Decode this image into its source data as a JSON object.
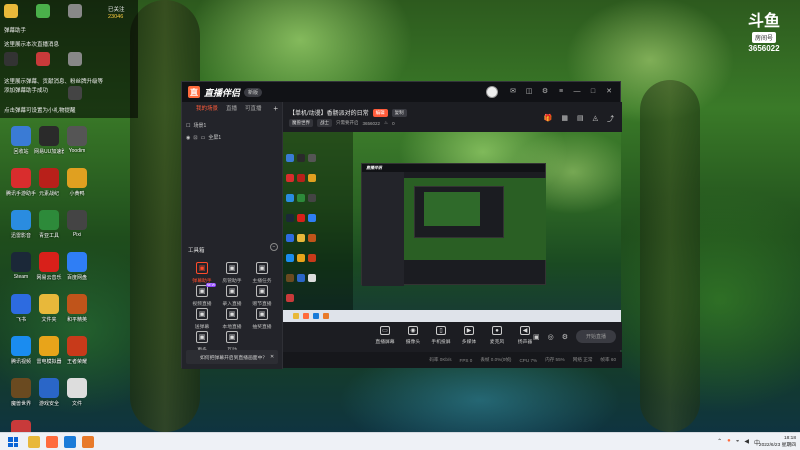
{
  "colors": {
    "accent": "#ff5b3a",
    "app_bg": "#1c1d22",
    "panel_bg": "#23242a"
  },
  "overlay": {
    "lines": [
      "弹幕助手",
      "这里展示本次直播消息",
      "这里展示弹幕、贡献消息、粉丝牌升级等",
      "添加弹幕助手成功",
      "点击弹幕可设置为小礼物提醒"
    ],
    "count_label": "已关注",
    "count_value": "23046"
  },
  "desktop_icons": [
    {
      "label": "回收站",
      "icon": "recycle-bin-icon",
      "color": "#3a7bd5"
    },
    {
      "label": "网易UU加速器",
      "icon": "uu-icon",
      "color": "#2a2a2a"
    },
    {
      "label": "Yoodim",
      "icon": "app-icon",
      "color": "#555"
    },
    {
      "label": "腾讯手游助手",
      "icon": "game-icon",
      "color": "#d92d2d"
    },
    {
      "label": "元素战纪",
      "icon": "game-icon",
      "color": "#b8201a"
    },
    {
      "label": "小黄鸭",
      "icon": "duck-icon",
      "color": "#e0a020"
    },
    {
      "label": "迅雷影音",
      "icon": "player-icon",
      "color": "#2a8ce0"
    },
    {
      "label": "青亚工具",
      "icon": "tool-icon",
      "color": "#2d8a3a"
    },
    {
      "label": "Pixi",
      "icon": "app-icon",
      "color": "#444"
    },
    {
      "label": "Steam",
      "icon": "steam-icon",
      "color": "#1b2838"
    },
    {
      "label": "网易云音乐",
      "icon": "music-icon",
      "color": "#d8201a"
    },
    {
      "label": "百度网盘",
      "icon": "cloud-icon",
      "color": "#2f7ef5"
    },
    {
      "label": "飞书",
      "icon": "app-icon",
      "color": "#2d6be0"
    },
    {
      "label": "文件夹",
      "icon": "folder-icon",
      "color": "#e8b83a"
    },
    {
      "label": "和平精英",
      "icon": "game-icon",
      "color": "#c0541a"
    },
    {
      "label": "腾讯视频",
      "icon": "video-icon",
      "color": "#1a8cf0"
    },
    {
      "label": "雷电模拟器",
      "icon": "emulator-icon",
      "color": "#e8a41a"
    },
    {
      "label": "王者荣耀",
      "icon": "game-icon",
      "color": "#c83a1a"
    },
    {
      "label": "魔兽世界",
      "icon": "wow-icon",
      "color": "#6a4a20"
    },
    {
      "label": "游戏安全",
      "icon": "shield-icon",
      "color": "#2a66c8"
    },
    {
      "label": "文件",
      "icon": "file-icon",
      "color": "#ddd"
    },
    {
      "label": "云游戏",
      "icon": "cloud-game-icon",
      "color": "#c83a3a"
    }
  ],
  "room_badge": {
    "logo": "斗鱼",
    "label": "房间号",
    "number": "3656022"
  },
  "app": {
    "name": "直播伴侣",
    "version": "新版",
    "tabs": [
      "我的场景",
      "直播",
      "可直播"
    ],
    "scene_items": [
      "场景1",
      "全屏1"
    ],
    "tools_title": "工具箱",
    "tools": [
      {
        "label": "弹幕助手",
        "icon": "danmaku-icon",
        "highlight": true
      },
      {
        "label": "房管助手",
        "icon": "person-icon",
        "highlight": false
      },
      {
        "label": "主播任务",
        "icon": "task-icon",
        "highlight": false
      },
      {
        "label": "视频直播",
        "icon": "video-icon",
        "highlight": false,
        "new": true
      },
      {
        "label": "录入直播",
        "icon": "download-icon",
        "highlight": false
      },
      {
        "label": "赠节直播",
        "icon": "gift-icon",
        "highlight": false
      },
      {
        "label": "送弹幕",
        "icon": "send-icon",
        "highlight": false
      },
      {
        "label": "本地直播",
        "icon": "download-icon",
        "highlight": false
      },
      {
        "label": "抽奖直播",
        "icon": "lottery-icon",
        "highlight": false
      },
      {
        "label": "更多",
        "icon": "more-icon",
        "highlight": false
      },
      {
        "label": "互动",
        "icon": "interact-icon",
        "highlight": false
      }
    ],
    "tools_new_badge": "NEW",
    "notice": "如何把弹幕开启到直播画面中？",
    "room_title": "【单机/动漫】香肠派对的日常",
    "room_tag": "编辑",
    "room_tag2": "复制",
    "room_sub": [
      "魔兽世界",
      "战士",
      "只需要开启",
      "3656022",
      "0"
    ],
    "bottom_actions": [
      {
        "label": "直播屏幕",
        "icon": "screen-icon"
      },
      {
        "label": "摄像头",
        "icon": "camera-icon"
      },
      {
        "label": "手机投屏",
        "icon": "phone-icon"
      },
      {
        "label": "多媒体",
        "icon": "media-icon"
      },
      {
        "label": "麦克风",
        "icon": "mic-icon"
      },
      {
        "label": "扬声器",
        "icon": "speaker-icon"
      }
    ],
    "start_button": "开始直播",
    "status": [
      "码率 0Kb/s",
      "FPS 0",
      "丢帧 0.0%(0帧)",
      "CPU 7%",
      "内存 55%",
      "网络 正常",
      "帧率 60"
    ]
  },
  "taskbar": {
    "apps": [
      {
        "icon": "file-explorer-icon",
        "color": "#e8b83a"
      },
      {
        "icon": "douyu-icon",
        "color": "#ff6b3d"
      },
      {
        "icon": "edge-icon",
        "color": "#1a7bd8"
      },
      {
        "icon": "app-icon",
        "color": "#e87a2a"
      }
    ],
    "time": "18:18",
    "date": "2022/6/23 星期四"
  }
}
